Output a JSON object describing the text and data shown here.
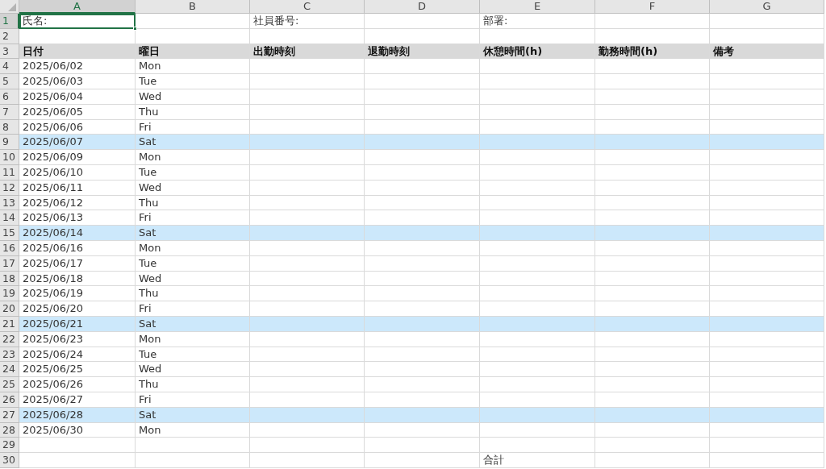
{
  "columns": [
    {
      "label": "A",
      "selected": true
    },
    {
      "label": "B",
      "selected": false
    },
    {
      "label": "C",
      "selected": false
    },
    {
      "label": "D",
      "selected": false
    },
    {
      "label": "E",
      "selected": false
    },
    {
      "label": "F",
      "selected": false
    },
    {
      "label": "G",
      "selected": false
    }
  ],
  "rows": [
    {
      "number": "1",
      "selected": true,
      "kind": "data",
      "highlighted": false,
      "cells": [
        "氏名:",
        null,
        "社員番号:",
        null,
        "部署:",
        null,
        null
      ]
    },
    {
      "number": "2",
      "selected": false,
      "kind": "data",
      "highlighted": false,
      "cells": [
        null,
        null,
        null,
        null,
        null,
        null,
        null
      ]
    },
    {
      "number": "3",
      "selected": false,
      "kind": "header",
      "highlighted": false,
      "cells": [
        "日付",
        "曜日",
        "出勤時刻",
        "退勤時刻",
        "休憩時間(h)",
        "勤務時間(h)",
        "備考"
      ]
    },
    {
      "number": "4",
      "selected": false,
      "kind": "data",
      "highlighted": false,
      "cells": [
        "2025/06/02",
        "Mon",
        null,
        null,
        null,
        null,
        null
      ]
    },
    {
      "number": "5",
      "selected": false,
      "kind": "data",
      "highlighted": false,
      "cells": [
        "2025/06/03",
        "Tue",
        null,
        null,
        null,
        null,
        null
      ]
    },
    {
      "number": "6",
      "selected": false,
      "kind": "data",
      "highlighted": false,
      "cells": [
        "2025/06/04",
        "Wed",
        null,
        null,
        null,
        null,
        null
      ]
    },
    {
      "number": "7",
      "selected": false,
      "kind": "data",
      "highlighted": false,
      "cells": [
        "2025/06/05",
        "Thu",
        null,
        null,
        null,
        null,
        null
      ]
    },
    {
      "number": "8",
      "selected": false,
      "kind": "data",
      "highlighted": false,
      "cells": [
        "2025/06/06",
        "Fri",
        null,
        null,
        null,
        null,
        null
      ]
    },
    {
      "number": "9",
      "selected": false,
      "kind": "data",
      "highlighted": true,
      "cells": [
        "2025/06/07",
        "Sat",
        null,
        null,
        null,
        null,
        null
      ]
    },
    {
      "number": "10",
      "selected": false,
      "kind": "data",
      "highlighted": false,
      "cells": [
        "2025/06/09",
        "Mon",
        null,
        null,
        null,
        null,
        null
      ]
    },
    {
      "number": "11",
      "selected": false,
      "kind": "data",
      "highlighted": false,
      "cells": [
        "2025/06/10",
        "Tue",
        null,
        null,
        null,
        null,
        null
      ]
    },
    {
      "number": "12",
      "selected": false,
      "kind": "data",
      "highlighted": false,
      "cells": [
        "2025/06/11",
        "Wed",
        null,
        null,
        null,
        null,
        null
      ]
    },
    {
      "number": "13",
      "selected": false,
      "kind": "data",
      "highlighted": false,
      "cells": [
        "2025/06/12",
        "Thu",
        null,
        null,
        null,
        null,
        null
      ]
    },
    {
      "number": "14",
      "selected": false,
      "kind": "data",
      "highlighted": false,
      "cells": [
        "2025/06/13",
        "Fri",
        null,
        null,
        null,
        null,
        null
      ]
    },
    {
      "number": "15",
      "selected": false,
      "kind": "data",
      "highlighted": true,
      "cells": [
        "2025/06/14",
        "Sat",
        null,
        null,
        null,
        null,
        null
      ]
    },
    {
      "number": "16",
      "selected": false,
      "kind": "data",
      "highlighted": false,
      "cells": [
        "2025/06/16",
        "Mon",
        null,
        null,
        null,
        null,
        null
      ]
    },
    {
      "number": "17",
      "selected": false,
      "kind": "data",
      "highlighted": false,
      "cells": [
        "2025/06/17",
        "Tue",
        null,
        null,
        null,
        null,
        null
      ]
    },
    {
      "number": "18",
      "selected": false,
      "kind": "data",
      "highlighted": false,
      "cells": [
        "2025/06/18",
        "Wed",
        null,
        null,
        null,
        null,
        null
      ]
    },
    {
      "number": "19",
      "selected": false,
      "kind": "data",
      "highlighted": false,
      "cells": [
        "2025/06/19",
        "Thu",
        null,
        null,
        null,
        null,
        null
      ]
    },
    {
      "number": "20",
      "selected": false,
      "kind": "data",
      "highlighted": false,
      "cells": [
        "2025/06/20",
        "Fri",
        null,
        null,
        null,
        null,
        null
      ]
    },
    {
      "number": "21",
      "selected": false,
      "kind": "data",
      "highlighted": true,
      "cells": [
        "2025/06/21",
        "Sat",
        null,
        null,
        null,
        null,
        null
      ]
    },
    {
      "number": "22",
      "selected": false,
      "kind": "data",
      "highlighted": false,
      "cells": [
        "2025/06/23",
        "Mon",
        null,
        null,
        null,
        null,
        null
      ]
    },
    {
      "number": "23",
      "selected": false,
      "kind": "data",
      "highlighted": false,
      "cells": [
        "2025/06/24",
        "Tue",
        null,
        null,
        null,
        null,
        null
      ]
    },
    {
      "number": "24",
      "selected": false,
      "kind": "data",
      "highlighted": false,
      "cells": [
        "2025/06/25",
        "Wed",
        null,
        null,
        null,
        null,
        null
      ]
    },
    {
      "number": "25",
      "selected": false,
      "kind": "data",
      "highlighted": false,
      "cells": [
        "2025/06/26",
        "Thu",
        null,
        null,
        null,
        null,
        null
      ]
    },
    {
      "number": "26",
      "selected": false,
      "kind": "data",
      "highlighted": false,
      "cells": [
        "2025/06/27",
        "Fri",
        null,
        null,
        null,
        null,
        null
      ]
    },
    {
      "number": "27",
      "selected": false,
      "kind": "data",
      "highlighted": true,
      "cells": [
        "2025/06/28",
        "Sat",
        null,
        null,
        null,
        null,
        null
      ]
    },
    {
      "number": "28",
      "selected": false,
      "kind": "data",
      "highlighted": false,
      "cells": [
        "2025/06/30",
        "Mon",
        null,
        null,
        null,
        null,
        null
      ]
    },
    {
      "number": "29",
      "selected": false,
      "kind": "data",
      "highlighted": false,
      "cells": [
        null,
        null,
        null,
        null,
        null,
        null,
        null
      ]
    },
    {
      "number": "30",
      "selected": false,
      "kind": "data",
      "highlighted": false,
      "cells": [
        null,
        null,
        null,
        null,
        "合計",
        null,
        null
      ]
    }
  ]
}
